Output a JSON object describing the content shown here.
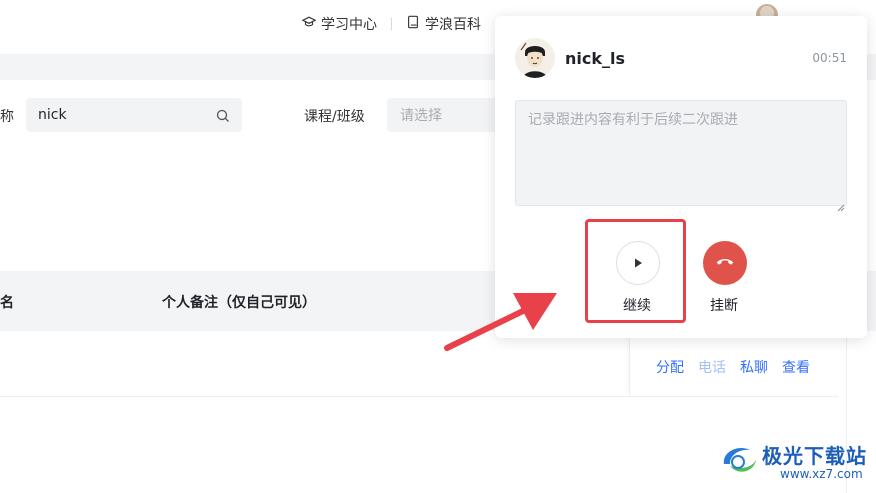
{
  "topnav": {
    "items": [
      {
        "label": "学习中心",
        "icon": "graduation-cap-icon"
      },
      {
        "label": "学浪百科",
        "icon": "book-icon"
      }
    ]
  },
  "filters": {
    "nickname_label_cut": "称",
    "search_value": "nick",
    "course_label": "课程/班级",
    "course_placeholder": "请选择"
  },
  "table": {
    "headers": [
      "名",
      "个人备注（仅自己可见）"
    ],
    "actions": [
      {
        "label": "分配",
        "enabled": true
      },
      {
        "label": "电话",
        "enabled": false
      },
      {
        "label": "私聊",
        "enabled": true
      },
      {
        "label": "查看",
        "enabled": true
      }
    ]
  },
  "call_popup": {
    "caller_name": "nick_ls",
    "timer": "00:51",
    "note_placeholder": "记录跟进内容有利于后续二次跟进",
    "continue_label": "继续",
    "hangup_label": "挂断"
  },
  "colors": {
    "link": "#3370ff",
    "link_disabled": "#a3c0f5",
    "hangup": "#e0534a",
    "highlight": "#e8414a"
  },
  "watermark": {
    "title": "极光下载站",
    "url": "www.xz7.com"
  }
}
